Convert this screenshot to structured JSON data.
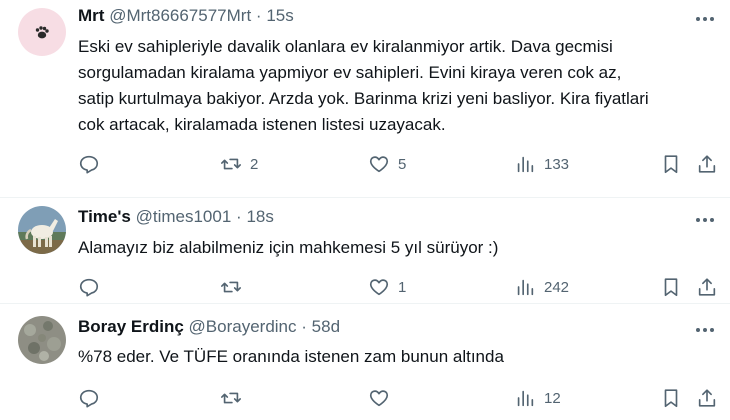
{
  "tweets": [
    {
      "name": "Mrt",
      "handle": "@Mrt86667577Mrt",
      "separator": "·",
      "time": "15s",
      "lines": [
        "Eski ev sahipleriyle davalik olanlara ev kiralanmiyor artik. Dava gecmisi",
        "sorgulamadan kiralama yapmiyor ev sahipleri. Evini kiraya veren cok az,",
        "satip kurtulmaya bakiyor. Arzda yok. Barinma krizi yeni basliyor. Kira fiyatlari",
        "cok artacak, kiralamada istenen listesi uzayacak."
      ],
      "retweets": "2",
      "likes": "5",
      "views": "133"
    },
    {
      "name": "Time's",
      "handle": "@times1001",
      "separator": "·",
      "time": "18s",
      "lines": [
        "Alamayız biz alabilmeniz için mahkemesi 5 yıl sürüyor  :)"
      ],
      "retweets": "",
      "likes": "1",
      "views": "242"
    },
    {
      "name": "Boray Erdinç",
      "handle": "@Borayerdinc",
      "separator": "·",
      "time": "58d",
      "lines": [
        "%78 eder. Ve TÜFE oranında istenen zam bunun altında"
      ],
      "retweets": "",
      "likes": "",
      "views": "12"
    }
  ],
  "colors": {
    "text": "#0f1419",
    "secondary": "#536471",
    "divider": "#eff3f4"
  },
  "icons": [
    "reply-icon",
    "retweet-icon",
    "like-icon",
    "views-icon",
    "bookmark-icon",
    "share-icon",
    "more-icon"
  ]
}
